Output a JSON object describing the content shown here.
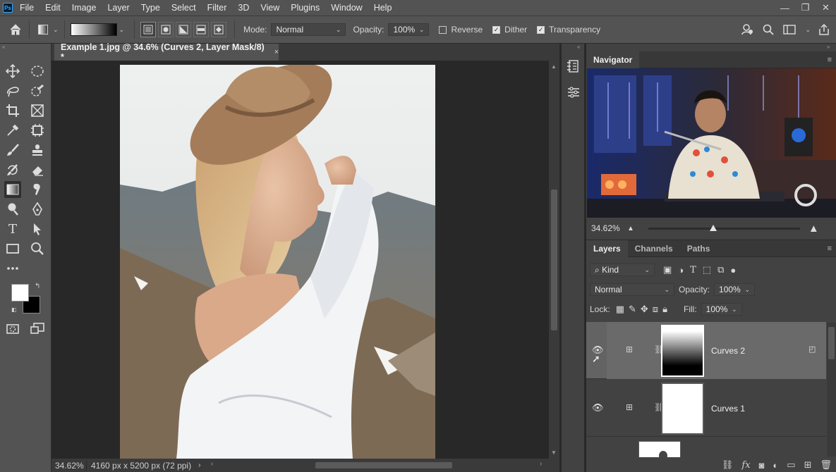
{
  "app": {
    "logo_text": "Ps",
    "menu": [
      "File",
      "Edit",
      "Image",
      "Layer",
      "Type",
      "Select",
      "Filter",
      "3D",
      "View",
      "Plugins",
      "Window",
      "Help"
    ]
  },
  "options_bar": {
    "mode_label": "Mode:",
    "mode_value": "Normal",
    "opacity_label": "Opacity:",
    "opacity_value": "100%",
    "reverse_label": "Reverse",
    "reverse_checked": false,
    "dither_label": "Dither",
    "dither_checked": true,
    "transparency_label": "Transparency",
    "transparency_checked": true
  },
  "document": {
    "tab_title": "Example 1.jpg @ 34.6% (Curves 2, Layer Mask/8) *",
    "tab_close": "×",
    "zoom_status": "34.62%",
    "doc_size": "4160 px x 5200 px (72 ppi)"
  },
  "navigator": {
    "title": "Navigator",
    "zoom": "34.62%"
  },
  "layers_panel": {
    "tabs": [
      "Layers",
      "Channels",
      "Paths"
    ],
    "filter_label": "Kind",
    "blend_mode": "Normal",
    "opacity_label": "Opacity:",
    "opacity_value": "100%",
    "lock_label": "Lock:",
    "fill_label": "Fill:",
    "fill_value": "100%",
    "layers": [
      {
        "name": "Curves 2",
        "selected": true,
        "visible": true,
        "mask": "gradient"
      },
      {
        "name": "Curves 1",
        "selected": false,
        "visible": true,
        "mask": "white"
      }
    ]
  },
  "colors": {
    "foreground": "#ffffff",
    "background": "#000000",
    "accent": "#31a8ff"
  }
}
